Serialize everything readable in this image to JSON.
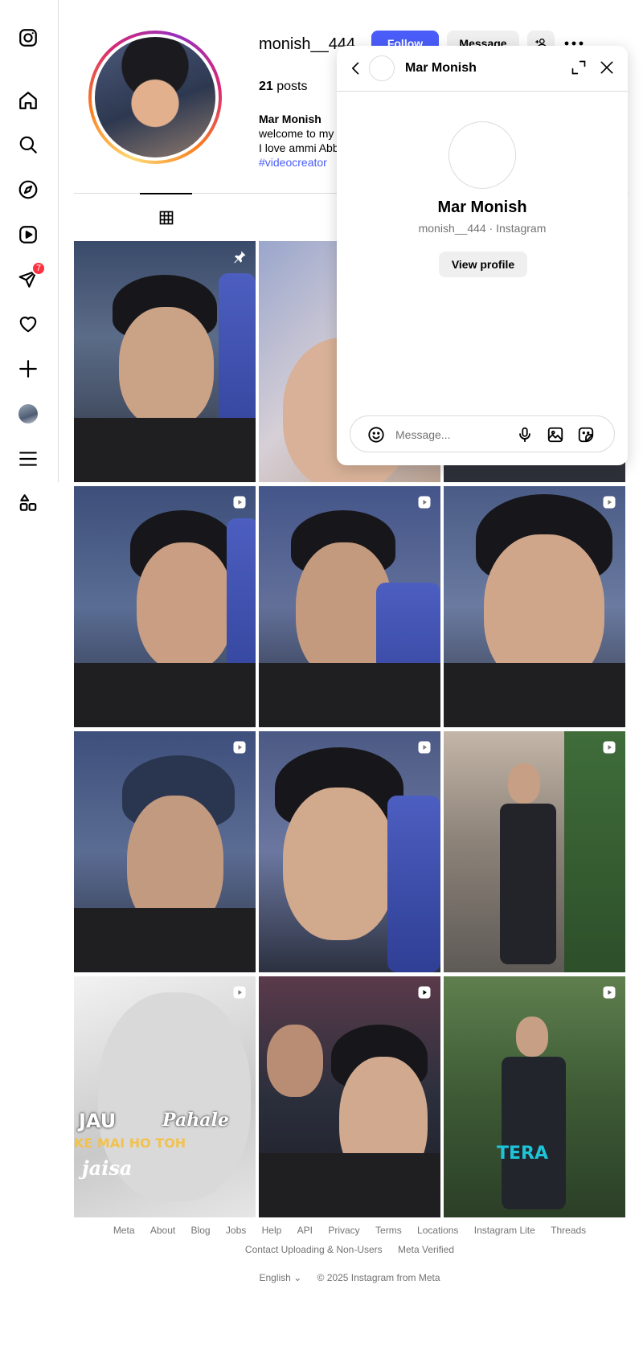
{
  "profile": {
    "username": "monish__444",
    "follow_label": "Follow",
    "message_label": "Message",
    "posts_count": "21",
    "posts_label": "posts",
    "full_name": "Mar Monish",
    "bio_lines": [
      "welcome to my",
      "I love ammi Abb"
    ],
    "hashtag": "#videocreator"
  },
  "nav": {
    "notification_count": "7"
  },
  "chat": {
    "header_name": "Mar Monish",
    "full_name": "Mar Monish",
    "subtitle": "monish__444 · Instagram",
    "view_profile_label": "View profile",
    "input_placeholder": "Message..."
  },
  "posts": [
    {
      "overlay": "pin-icon"
    },
    {
      "overlay": ""
    },
    {
      "overlay": ""
    },
    {
      "overlay": "reel-icon"
    },
    {
      "overlay": "reel-icon"
    },
    {
      "overlay": "reel-icon"
    },
    {
      "overlay": "reel-icon"
    },
    {
      "overlay": "reel-icon"
    },
    {
      "overlay": "reel-icon"
    },
    {
      "overlay": "reel-icon"
    },
    {
      "overlay": "reel-icon"
    },
    {
      "overlay": "reel-icon"
    }
  ],
  "post_captions": {
    "post10_line1": "JAU",
    "post10_line2": "Pahale",
    "post10_line3": "KE MAI HO TOH",
    "post10_line4": "jaisa",
    "post12_text": "TERA"
  },
  "footer": {
    "links_row1": [
      "Meta",
      "About",
      "Blog",
      "Jobs",
      "Help",
      "API",
      "Privacy",
      "Terms",
      "Locations",
      "Instagram Lite",
      "Threads"
    ],
    "links_row2": [
      "Contact Uploading & Non-Users",
      "Meta Verified"
    ],
    "language": "English",
    "copyright": "© 2025 Instagram from Meta"
  },
  "colors": {
    "accent": "#4a5df9",
    "border": "#dbdbdb",
    "muted": "#737373",
    "badge": "#ff3040"
  }
}
